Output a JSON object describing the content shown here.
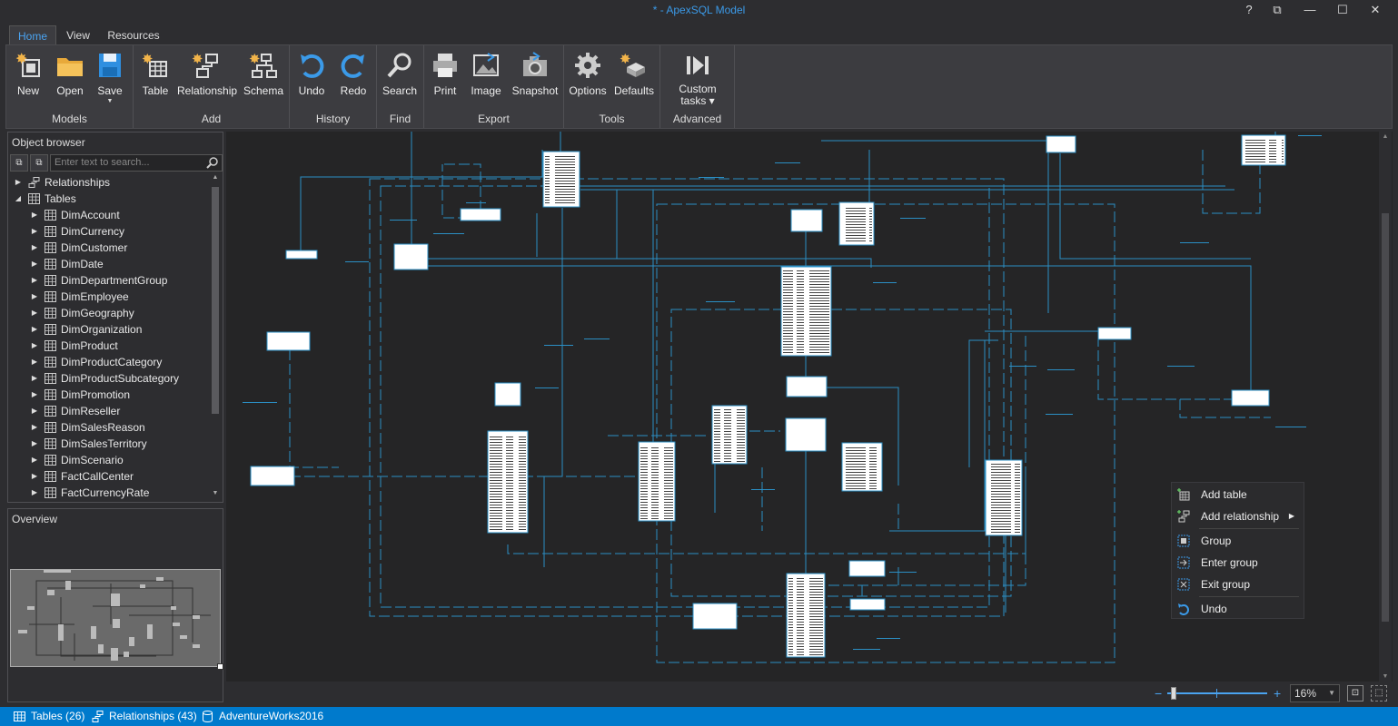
{
  "window": {
    "title": "* - ApexSQL Model",
    "controls": [
      "?",
      "⧉",
      "—",
      "☐",
      "✕"
    ]
  },
  "tabs": [
    {
      "label": "Home",
      "active": true
    },
    {
      "label": "View",
      "active": false
    },
    {
      "label": "Resources",
      "active": false
    }
  ],
  "ribbon": {
    "groups": [
      {
        "label": "Models",
        "buttons": [
          {
            "label": "New",
            "icon": "new-model-icon"
          },
          {
            "label": "Open",
            "icon": "folder-icon"
          },
          {
            "label": "Save",
            "icon": "save-icon",
            "dropdown": true
          }
        ]
      },
      {
        "label": "Add",
        "buttons": [
          {
            "label": "Table",
            "icon": "add-table-icon"
          },
          {
            "label": "Relationship",
            "icon": "add-relationship-icon"
          },
          {
            "label": "Schema",
            "icon": "add-schema-icon"
          }
        ]
      },
      {
        "label": "History",
        "buttons": [
          {
            "label": "Undo",
            "icon": "undo-icon"
          },
          {
            "label": "Redo",
            "icon": "redo-icon"
          }
        ]
      },
      {
        "label": "Find",
        "buttons": [
          {
            "label": "Search",
            "icon": "search-icon"
          }
        ]
      },
      {
        "label": "Export",
        "buttons": [
          {
            "label": "Print",
            "icon": "print-icon"
          },
          {
            "label": "Image",
            "icon": "image-icon"
          },
          {
            "label": "Snapshot",
            "icon": "snapshot-icon"
          }
        ]
      },
      {
        "label": "Tools",
        "buttons": [
          {
            "label": "Options",
            "icon": "gear-icon"
          },
          {
            "label": "Defaults",
            "icon": "defaults-icon"
          }
        ]
      },
      {
        "label": "Advanced",
        "buttons": [
          {
            "label": "Custom\ntasks",
            "icon": "custom-tasks-icon",
            "dropdown": true
          }
        ]
      }
    ]
  },
  "object_browser": {
    "title": "Object browser",
    "search_placeholder": "Enter text to search...",
    "nodes": [
      {
        "label": "Relationships",
        "level": 0,
        "expanded": false,
        "icon": "relationships-icon"
      },
      {
        "label": "Tables",
        "level": 0,
        "expanded": true,
        "icon": "tables-icon"
      },
      {
        "label": "DimAccount",
        "level": 1
      },
      {
        "label": "DimCurrency",
        "level": 1
      },
      {
        "label": "DimCustomer",
        "level": 1
      },
      {
        "label": "DimDate",
        "level": 1
      },
      {
        "label": "DimDepartmentGroup",
        "level": 1
      },
      {
        "label": "DimEmployee",
        "level": 1
      },
      {
        "label": "DimGeography",
        "level": 1
      },
      {
        "label": "DimOrganization",
        "level": 1
      },
      {
        "label": "DimProduct",
        "level": 1
      },
      {
        "label": "DimProductCategory",
        "level": 1
      },
      {
        "label": "DimProductSubcategory",
        "level": 1
      },
      {
        "label": "DimPromotion",
        "level": 1
      },
      {
        "label": "DimReseller",
        "level": 1
      },
      {
        "label": "DimSalesReason",
        "level": 1
      },
      {
        "label": "DimSalesTerritory",
        "level": 1
      },
      {
        "label": "DimScenario",
        "level": 1
      },
      {
        "label": "FactCallCenter",
        "level": 1
      },
      {
        "label": "FactCurrencyRate",
        "level": 1
      }
    ]
  },
  "overview": {
    "title": "Overview"
  },
  "context_menu": {
    "items": [
      {
        "label": "Add table",
        "icon": "add-table-icon"
      },
      {
        "label": "Add relationship",
        "icon": "add-relationship-icon",
        "submenu": true
      },
      {
        "label": "Group",
        "icon": "group-icon"
      },
      {
        "label": "Enter group",
        "icon": "enter-group-icon"
      },
      {
        "label": "Exit group",
        "icon": "exit-group-icon"
      },
      {
        "label": "Undo",
        "icon": "undo-icon"
      }
    ]
  },
  "zoom": {
    "value": "16%",
    "minus": "−",
    "plus": "+",
    "level_fraction": 0.16
  },
  "status": {
    "tables": "Tables (26)",
    "relationships": "Relationships (43)",
    "database": "AdventureWorks2016"
  },
  "colors": {
    "accent": "#007acc",
    "link_blue": "#3b9ae8",
    "line": "#2b8fc4"
  }
}
